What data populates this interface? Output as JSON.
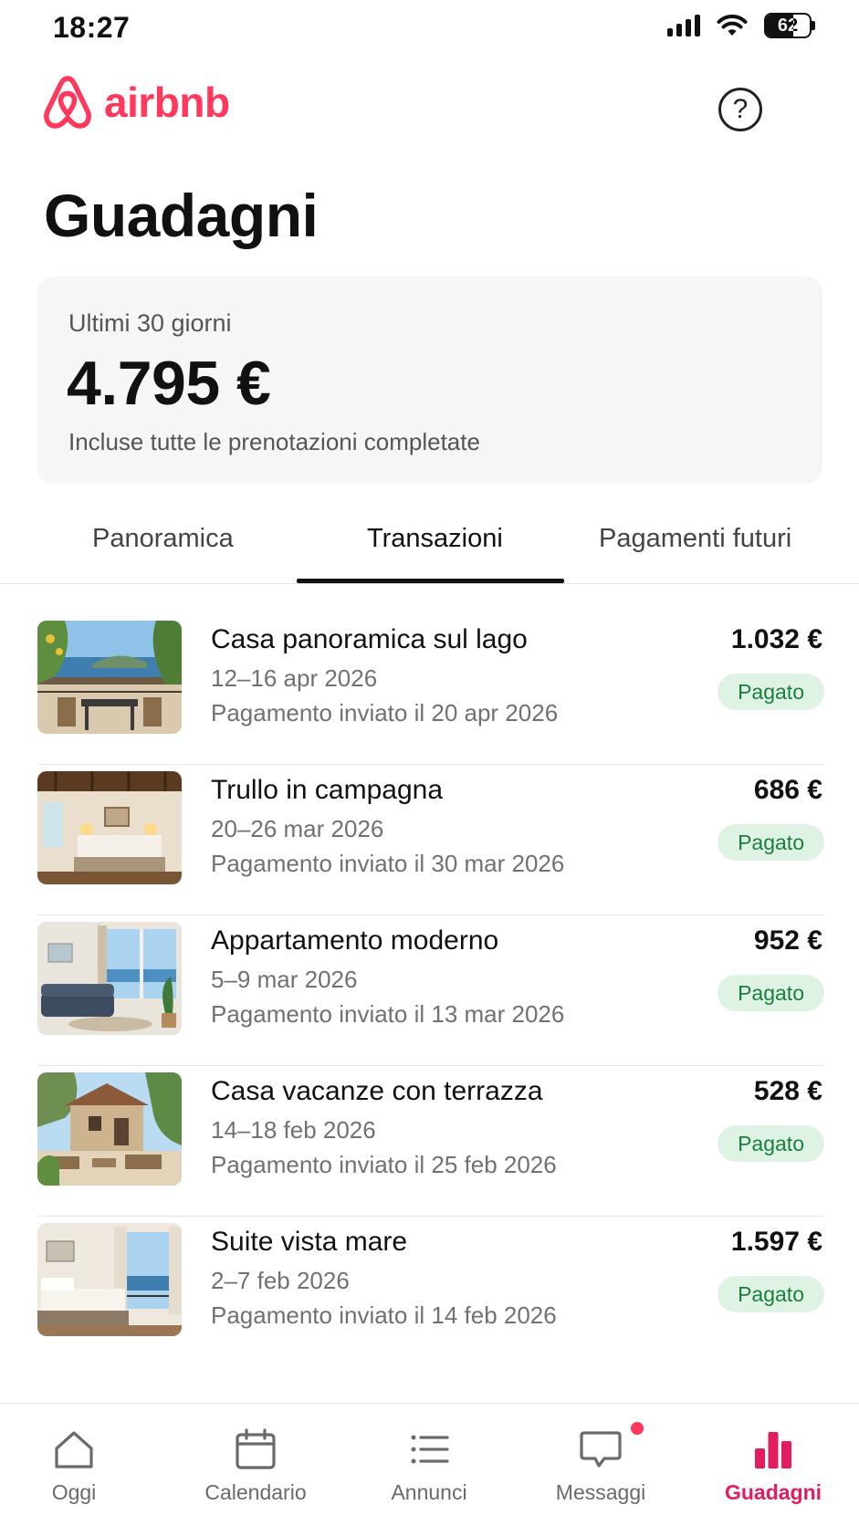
{
  "status_bar": {
    "time": "18:27",
    "battery": "62",
    "battery_level": 0.62
  },
  "header": {
    "logo_text": "airbnb",
    "help_icon": "question-circle-icon",
    "brand_color": "#FF385C"
  },
  "page": {
    "title": "Guadagni"
  },
  "summary": {
    "label": "Ultimi 30 giorni",
    "amount": "4.795 €",
    "note": "Incluse tutte le prenotazioni completate"
  },
  "tabs": [
    {
      "label": "Panoramica",
      "active": false
    },
    {
      "label": "Transazioni",
      "active": true
    },
    {
      "label": "Pagamenti futuri",
      "active": false
    }
  ],
  "transactions": [
    {
      "title": "Casa panoramica sul lago",
      "dates": "12–16 apr 2026",
      "payout": "Pagamento inviato il 20 apr 2026",
      "amount": "1.032 €",
      "status": "Pagato",
      "image": "terrace-lake-view"
    },
    {
      "title": "Trullo in campagna",
      "dates": "20–26 mar 2026",
      "payout": "Pagamento inviato il 30 mar 2026",
      "amount": "686 €",
      "status": "Pagato",
      "image": "bedroom-wood-beams"
    },
    {
      "title": "Appartamento moderno",
      "dates": "5–9 mar 2026",
      "payout": "Pagamento inviato il 13 mar 2026",
      "amount": "952 €",
      "status": "Pagato",
      "image": "living-room-sea-view"
    },
    {
      "title": "Casa vacanze con terrazza",
      "dates": "14–18 feb 2026",
      "payout": "Pagamento inviato il 25 feb 2026",
      "amount": "528 €",
      "status": "Pagato",
      "image": "stone-house-terrace"
    },
    {
      "title": "Suite vista mare",
      "dates": "2–7 feb 2026",
      "payout": "Pagamento inviato il 14 feb 2026",
      "amount": "1.597 €",
      "status": "Pagato",
      "image": "bedroom-sea-balcony"
    }
  ],
  "bottom_nav": [
    {
      "label": "Oggi",
      "icon": "home-icon",
      "active": false
    },
    {
      "label": "Calendario",
      "icon": "calendar-icon",
      "active": false
    },
    {
      "label": "Annunci",
      "icon": "list-icon",
      "active": false
    },
    {
      "label": "Messaggi",
      "icon": "message-icon",
      "active": false,
      "has_notification": true
    },
    {
      "label": "Guadagni",
      "icon": "bar-chart-icon",
      "active": true
    }
  ],
  "colors": {
    "accent": "#FF385C",
    "active_nav": "#E31C5F",
    "paid_badge_bg": "#dff3e4",
    "paid_badge_text": "#1a7f3c"
  }
}
